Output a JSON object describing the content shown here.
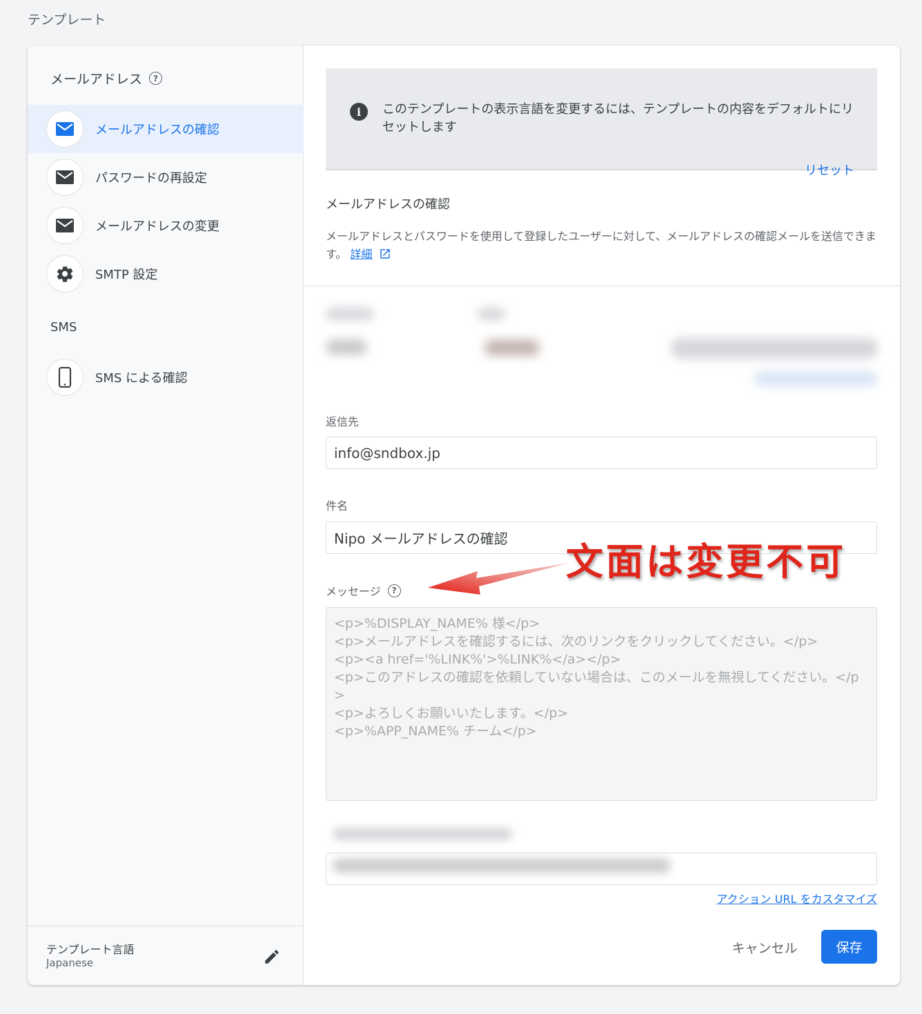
{
  "page_title": "テンプレート",
  "sidebar": {
    "email_heading": "メールアドレス",
    "items": [
      {
        "label": "メールアドレスの確認",
        "icon": "mail-icon",
        "active": true
      },
      {
        "label": "パスワードの再設定",
        "icon": "mail-icon",
        "active": false
      },
      {
        "label": "メールアドレスの変更",
        "icon": "mail-icon",
        "active": false
      },
      {
        "label": "SMTP 設定",
        "icon": "gear-icon",
        "active": false
      }
    ],
    "sms_heading": "SMS",
    "sms_items": [
      {
        "label": "SMS による確認",
        "icon": "phone-icon",
        "active": false
      }
    ],
    "footer": {
      "label": "テンプレート言語",
      "value": "Japanese"
    }
  },
  "main": {
    "info": {
      "text": "このテンプレートの表示言語を変更するには、テンプレートの内容をデフォルトにリセットします",
      "reset_label": "リセット"
    },
    "section_title": "メールアドレスの確認",
    "section_desc": "メールアドレスとパスワードを使用して登録したユーザーに対して、メールアドレスの確認メールを送信できます。",
    "details_link": "詳細",
    "reply_to": {
      "label": "返信先",
      "value": "info@sndbox.jp"
    },
    "subject": {
      "label": "件名",
      "value": "Nipo メールアドレスの確認"
    },
    "message": {
      "label": "メッセージ",
      "value": "<p>%DISPLAY_NAME% 様</p>\n<p>メールアドレスを確認するには、次のリンクをクリックしてください。</p>\n<p><a href='%LINK%'>%LINK%</a></p>\n<p>このアドレスの確認を依頼していない場合は、このメールを無視してください。</p>\n<p>よろしくお願いいたします。</p>\n<p>%APP_NAME% チーム</p>"
    },
    "action_url_link": "アクション URL をカスタマイズ",
    "cancel_label": "キャンセル",
    "save_label": "保存"
  },
  "annotation": {
    "text": "文面は変更不可",
    "color": "#e0251a"
  },
  "colors": {
    "accent": "#1a73e8",
    "active_bg": "#e8f0fe"
  }
}
